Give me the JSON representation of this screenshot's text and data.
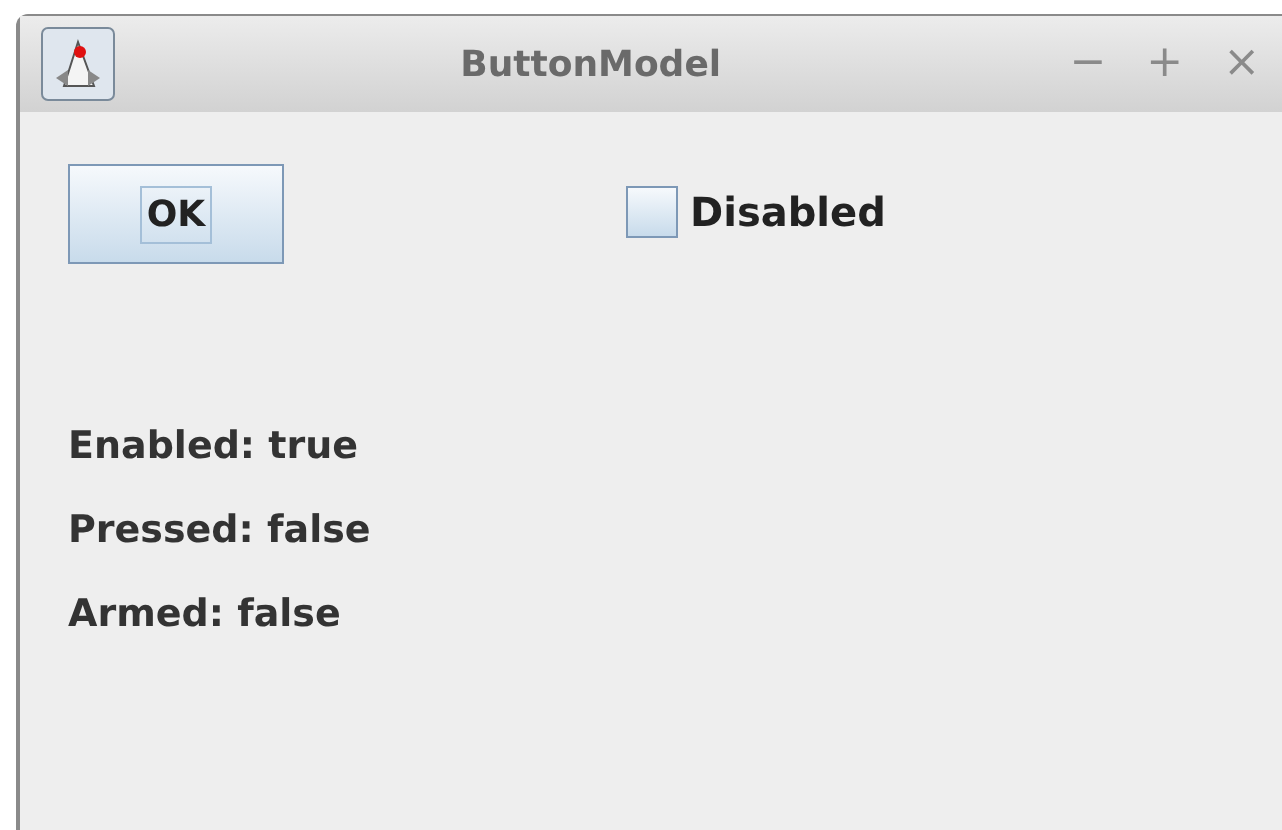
{
  "window": {
    "title": "ButtonModel",
    "controls": [
      "−",
      "+",
      "×"
    ]
  },
  "ok_button": {
    "label": "OK",
    "focused": true
  },
  "disabled_checkbox": {
    "label": "Disabled",
    "checked": false
  },
  "status_lines": [
    "Enabled: true",
    "Pressed: false",
    "Armed: false"
  ]
}
